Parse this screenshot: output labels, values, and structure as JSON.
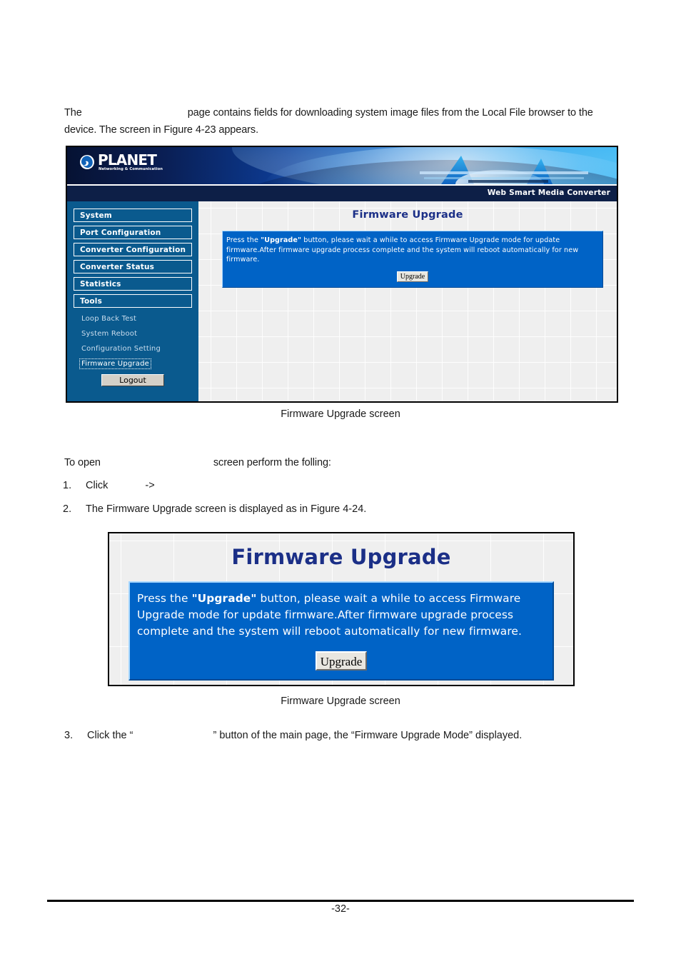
{
  "document": {
    "intro_before_gap": "The",
    "intro_after_gap": "page contains fields for downloading system image files from the Local File browser  to the device. The screen in Figure 4-23 appears.",
    "figure1_caption": "Firmware Upgrade screen",
    "to_open_before_gap": "To open",
    "to_open_after_gap": "screen perform the folling:",
    "step1_number": "1.",
    "step1_before_gap": "Click",
    "step1_after_gap": "->",
    "step2_number": "2.",
    "step2_text": "The Firmware Upgrade screen is displayed as in Figure 4-24.",
    "figure2_caption": "Firmware Upgrade screen",
    "step3_number": "3.",
    "step3_before_gap": "Click the “",
    "step3_after_gap": "” button of the main page, the “Firmware Upgrade Mode” displayed.",
    "page_number": "-32-"
  },
  "ui": {
    "logo": {
      "wordmark": "PLANET",
      "tagline": "Networking & Communication"
    },
    "product_name": "Web Smart Media Converter",
    "sidebar": {
      "buttons": [
        {
          "label": "System"
        },
        {
          "label": "Port Configuration"
        },
        {
          "label": "Converter Configuration"
        },
        {
          "label": "Converter Status"
        },
        {
          "label": "Statistics"
        },
        {
          "label": "Tools"
        }
      ],
      "sub_items": [
        {
          "label": "Loop Back Test",
          "selected": false
        },
        {
          "label": "System Reboot",
          "selected": false
        },
        {
          "label": "Configuration Setting",
          "selected": false
        },
        {
          "label": "Firmware Upgrade",
          "selected": true
        }
      ],
      "logout_label": "Logout"
    },
    "panel": {
      "title": "Firmware Upgrade",
      "message_part1": "Press the ",
      "message_bold": "\"Upgrade\"",
      "message_part2": " button, please wait a while to access Firmware Upgrade mode for update firmware.After firmware upgrade process complete and the system will reboot automatically for new firmware.",
      "button_label": "Upgrade"
    }
  },
  "colors": {
    "sidebar_blue": "#0a5a8e",
    "message_blue": "#0063c6",
    "title_navy": "#1b2f87",
    "titlebar_navy": "#0d1f47",
    "content_gray": "#efefef"
  }
}
